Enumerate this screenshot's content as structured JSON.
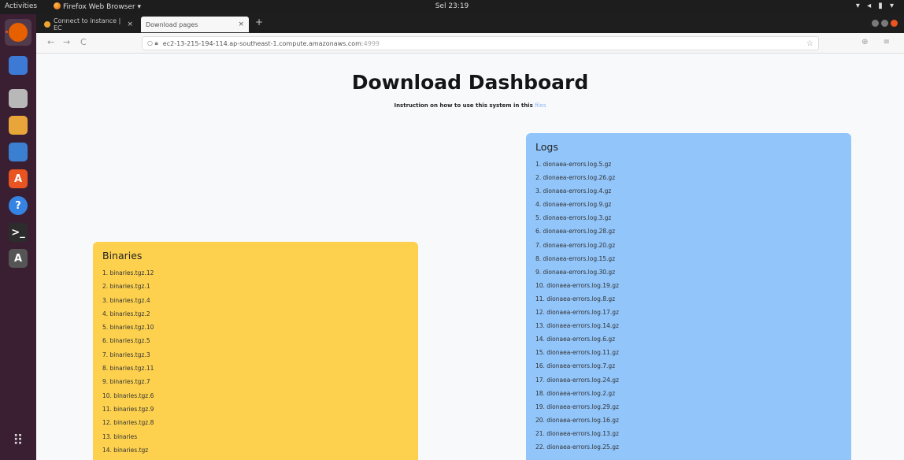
{
  "topbar": {
    "activities": "Activities",
    "app_name": "Firefox Web Browser ▾",
    "clock": "Sel 23:19",
    "system_icons": "▾ ◂ ▮ ▾"
  },
  "dock": {
    "items": [
      {
        "name": "firefox",
        "color": "#e66000",
        "glyph": ""
      },
      {
        "name": "thunderbird",
        "color": "#3d7ad6",
        "glyph": ""
      },
      {
        "name": "files",
        "color": "#b8b8b8",
        "glyph": ""
      },
      {
        "name": "rhythmbox",
        "color": "#e8a53a",
        "glyph": ""
      },
      {
        "name": "libreoffice-writer",
        "color": "#3b7fd1",
        "glyph": ""
      },
      {
        "name": "software-center",
        "color": "#e95420",
        "glyph": "A"
      },
      {
        "name": "help",
        "color": "#3584e4",
        "glyph": "?"
      },
      {
        "name": "terminal",
        "color": "#2c2c2c",
        "glyph": ">_"
      },
      {
        "name": "software-updater",
        "color": "#555555",
        "glyph": "A"
      }
    ],
    "app_grid": "⠿"
  },
  "browser": {
    "tabs": [
      {
        "label": "Connect to instance | EC",
        "close": "×"
      },
      {
        "label": "Download pages",
        "close": "×"
      }
    ],
    "new_tab": "+",
    "back": "←",
    "forward": "→",
    "reload": "C",
    "url": "ec2-13-215-194-114.ap-southeast-1.compute.amazonaws.com",
    "url_port": ":4999",
    "bookmark_star": "☆",
    "right_icons": "⊕ ≡"
  },
  "page": {
    "title": "Download Dashboard",
    "subtitle": "Instruction on how to use this system in this",
    "subtitle_link": "files"
  },
  "binaries": {
    "heading": "Binaries",
    "items": [
      "1. binaries.tgz.12",
      "2. binaries.tgz.1",
      "3. binaries.tgz.4",
      "4. binaries.tgz.2",
      "5. binaries.tgz.10",
      "6. binaries.tgz.5",
      "7. binaries.tgz.3",
      "8. binaries.tgz.11",
      "9. binaries.tgz.7",
      "10. binaries.tgz.6",
      "11. binaries.tgz.9",
      "12. binaries.tgz.8",
      "13. binaries",
      "14. binaries.tgz"
    ],
    "color": "#fdd14e"
  },
  "logs": {
    "heading": "Logs",
    "items": [
      "1. dionaea-errors.log.5.gz",
      "2. dionaea-errors.log.26.gz",
      "3. dionaea-errors.log.4.gz",
      "4. dionaea-errors.log.9.gz",
      "5. dionaea-errors.log.3.gz",
      "6. dionaea-errors.log.28.gz",
      "7. dionaea-errors.log.20.gz",
      "8. dionaea-errors.log.15.gz",
      "9. dionaea-errors.log.30.gz",
      "10. dionaea-errors.log.19.gz",
      "11. dionaea-errors.log.8.gz",
      "12. dionaea-errors.log.17.gz",
      "13. dionaea-errors.log.14.gz",
      "14. dionaea-errors.log.6.gz",
      "15. dionaea-errors.log.11.gz",
      "16. dionaea-errors.log.7.gz",
      "17. dionaea-errors.log.24.gz",
      "18. dionaea-errors.log.2.gz",
      "19. dionaea-errors.log.29.gz",
      "20. dionaea-errors.log.16.gz",
      "21. dionaea-errors.log.13.gz",
      "22. dionaea-errors.log.25.gz"
    ],
    "color": "#92c5fa"
  }
}
